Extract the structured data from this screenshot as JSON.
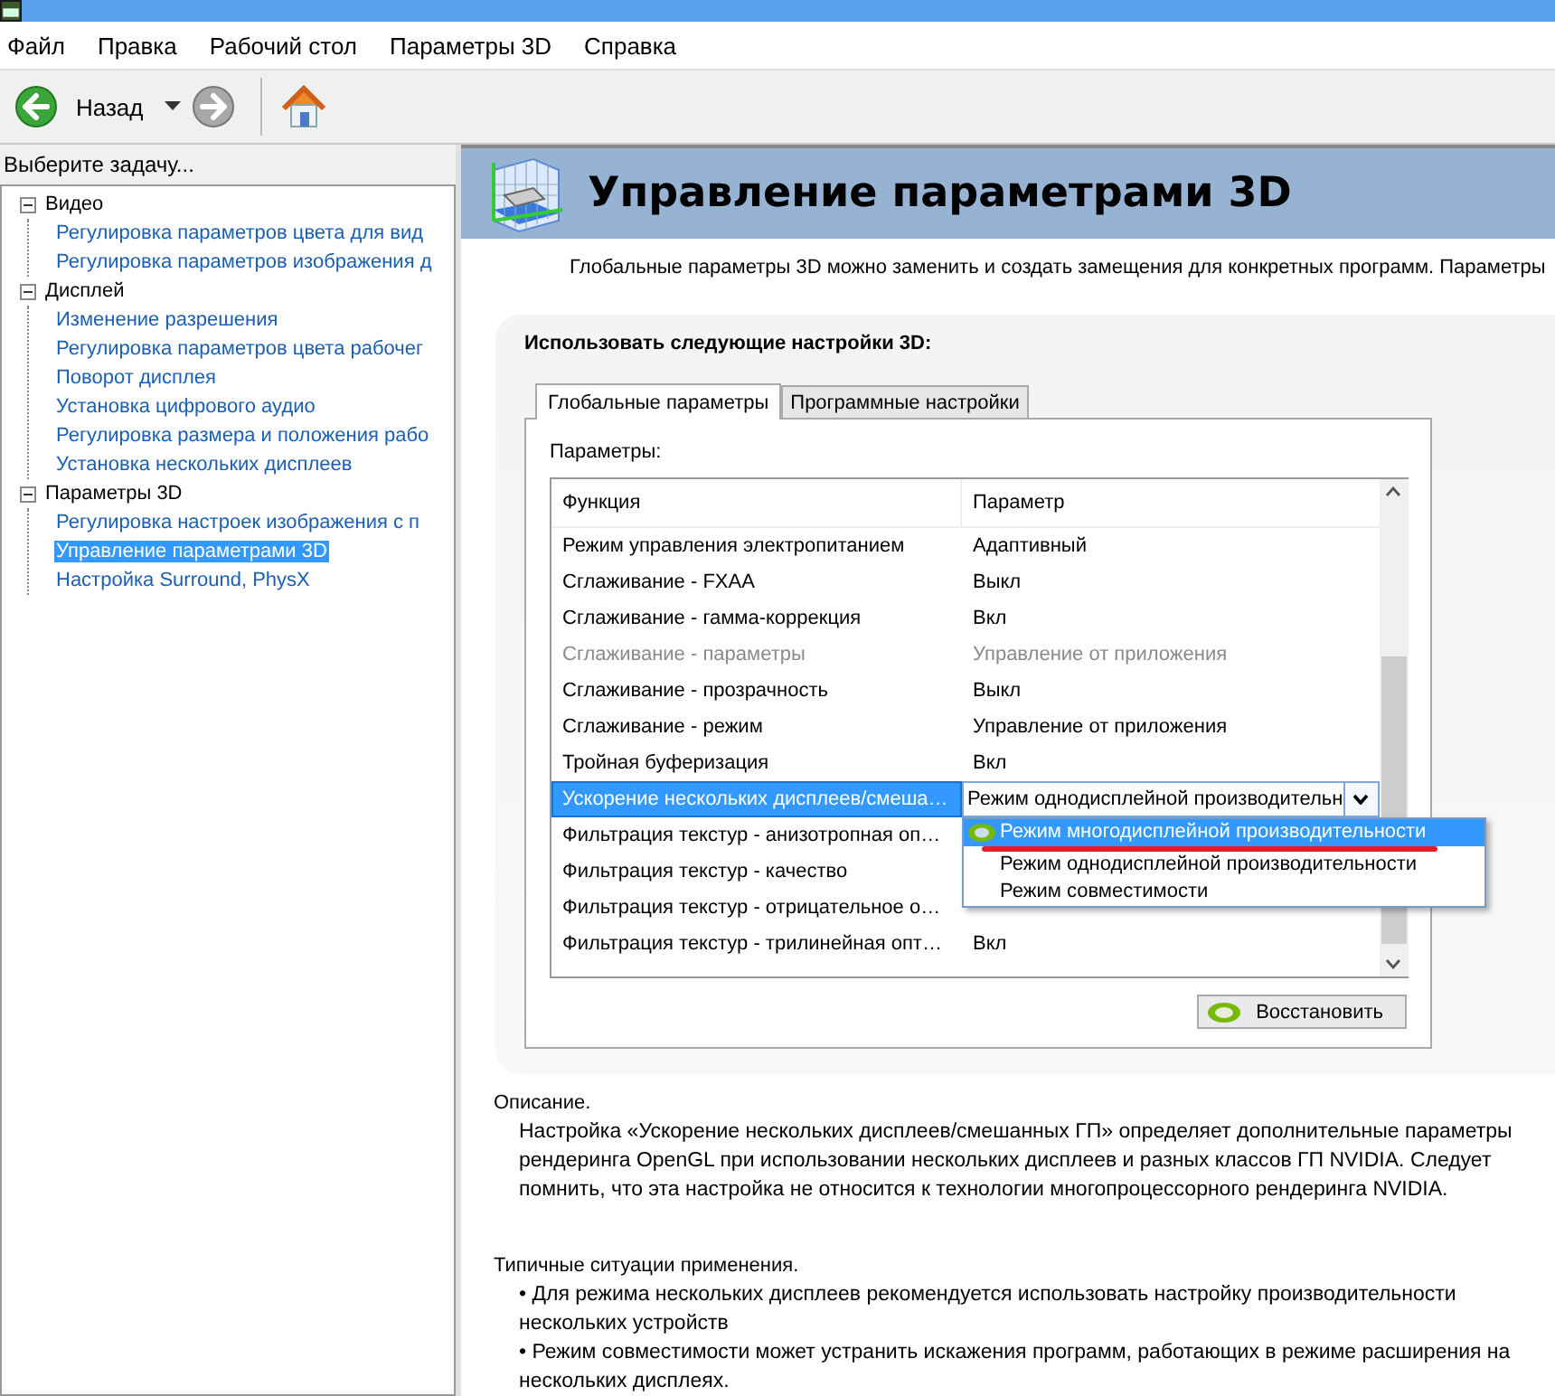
{
  "menu": [
    "Файл",
    "Правка",
    "Рабочий стол",
    "Параметры 3D",
    "Справка"
  ],
  "toolbar": {
    "back_label": "Назад"
  },
  "sidebar": {
    "title": "Выберите задачу...",
    "tree": [
      {
        "label": "Видео",
        "expanded": true,
        "selected": false,
        "children": [
          {
            "label": "Регулировка параметров цвета для вид",
            "selected": false
          },
          {
            "label": "Регулировка параметров изображения д",
            "selected": false
          }
        ]
      },
      {
        "label": "Дисплей",
        "expanded": true,
        "selected": false,
        "children": [
          {
            "label": "Изменение разрешения",
            "selected": false
          },
          {
            "label": "Регулировка параметров цвета рабочег",
            "selected": false
          },
          {
            "label": "Поворот дисплея",
            "selected": false
          },
          {
            "label": "Установка цифрового аудио",
            "selected": false
          },
          {
            "label": "Регулировка размера и положения рабо",
            "selected": false
          },
          {
            "label": "Установка нескольких дисплеев",
            "selected": false
          }
        ]
      },
      {
        "label": "Параметры 3D",
        "expanded": true,
        "selected": false,
        "children": [
          {
            "label": "Регулировка настроек изображения с п",
            "selected": false
          },
          {
            "label": "Управление параметрами 3D",
            "selected": true
          },
          {
            "label": "Настройка Surround, PhysX",
            "selected": false
          }
        ]
      }
    ]
  },
  "page": {
    "title": "Управление параметрами 3D",
    "subtitle": "Глобальные параметры 3D можно заменить и создать замещения для конкретных программ. Параметры"
  },
  "settings": {
    "title": "Использовать следующие настройки 3D:",
    "tabs": [
      {
        "label": "Глобальные параметры",
        "selected": true
      },
      {
        "label": "Программные настройки",
        "selected": false
      }
    ],
    "params_label": "Параметры:",
    "columns": [
      "Функция",
      "Параметр"
    ],
    "rows": [
      {
        "function": "Режим управления электропитанием",
        "value": "Адаптивный",
        "disabled": false,
        "selected": false
      },
      {
        "function": "Сглаживание - FXAA",
        "value": "Выкл",
        "disabled": false,
        "selected": false
      },
      {
        "function": "Сглаживание - гамма-коррекция",
        "value": "Вкл",
        "disabled": false,
        "selected": false
      },
      {
        "function": "Сглаживание - параметры",
        "value": "Управление от приложения",
        "disabled": true,
        "selected": false
      },
      {
        "function": "Сглаживание - прозрачность",
        "value": "Выкл",
        "disabled": false,
        "selected": false
      },
      {
        "function": "Сглаживание - режим",
        "value": "Управление от приложения",
        "disabled": false,
        "selected": false
      },
      {
        "function": "Тройная буферизация",
        "value": "Вкл",
        "disabled": false,
        "selected": false
      },
      {
        "function": "Ускорение нескольких дисплеев/смеша…",
        "value": "Режим однодисплейной производительн",
        "disabled": false,
        "selected": true,
        "dropdown": {
          "options": [
            {
              "label": "Режим многодисплейной производительности",
              "selected": true,
              "underlined": true
            },
            {
              "label": "Режим однодисплейной производительности",
              "selected": false,
              "underlined": false
            },
            {
              "label": "Режим совместимости",
              "selected": false,
              "underlined": false
            }
          ]
        }
      },
      {
        "function": "Фильтрация текстур - анизотропная оп…",
        "disabled": false,
        "selected": false
      },
      {
        "function": "Фильтрация текстур - качество",
        "disabled": false,
        "selected": false
      },
      {
        "function": "Фильтрация текстур - отрицательное о…",
        "disabled": false,
        "selected": false
      },
      {
        "function": "Фильтрация текстур - трилинейная опт…",
        "value": "Вкл",
        "disabled": false,
        "selected": false
      }
    ],
    "restore_label": "Восстановить"
  },
  "description": {
    "title": "Описание.",
    "text": "Настройка «Ускорение нескольких дисплеев/смешанных ГП» определяет дополнительные параметры рендеринга OpenGL при использовании нескольких дисплеев и разных классов ГП NVIDIA. Следует помнить, что эта настройка не относится к технологии многопроцессорного рендеринга NVIDIA."
  },
  "usage": {
    "title": "Типичные ситуации применения.",
    "items": [
      "• Для режима нескольких дисплеев рекомендуется использовать настройку производительности нескольких устройств",
      "• Режим совместимости может устранить искажения программ, работающих в режиме расширения на нескольких дисплеях."
    ]
  }
}
